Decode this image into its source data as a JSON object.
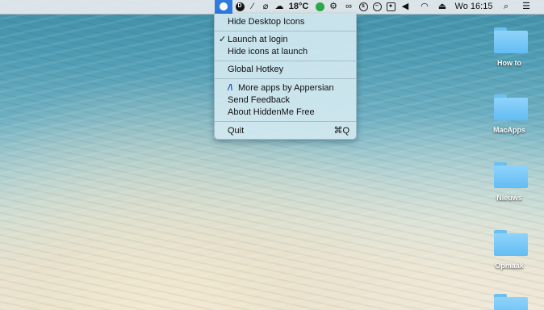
{
  "menubar": {
    "weather": "18°C",
    "clock": "Wo 16:15",
    "icons": [
      "hiddenme-icon",
      "d-icon",
      "wand-icon",
      "paperclip-icon",
      "weather-cloud-icon",
      "spotify-icon",
      "gear-icon",
      "glasses-icon",
      "circle-s-icon",
      "minus-circle-icon",
      "record-icon",
      "volume-icon",
      "wifi-icon",
      "eject-icon",
      "search-icon",
      "list-icon"
    ]
  },
  "menu": {
    "items": {
      "hide_desktop": "Hide Desktop Icons",
      "launch_login": "Launch at login",
      "launch_login_checked": "✓",
      "hide_icons_launch": "Hide icons at launch",
      "global_hotkey": "Global Hotkey",
      "more_apps": "More apps by Appersian",
      "send_feedback": "Send Feedback",
      "about": "About HiddenMe Free",
      "quit": "Quit",
      "quit_shortcut": "⌘Q"
    }
  },
  "desktop": {
    "folders": [
      "How to",
      "MacApps",
      "Nieuws",
      "Opmaak"
    ]
  },
  "colors": {
    "accent": "#2f7be0",
    "folder": "#63bdf3"
  }
}
